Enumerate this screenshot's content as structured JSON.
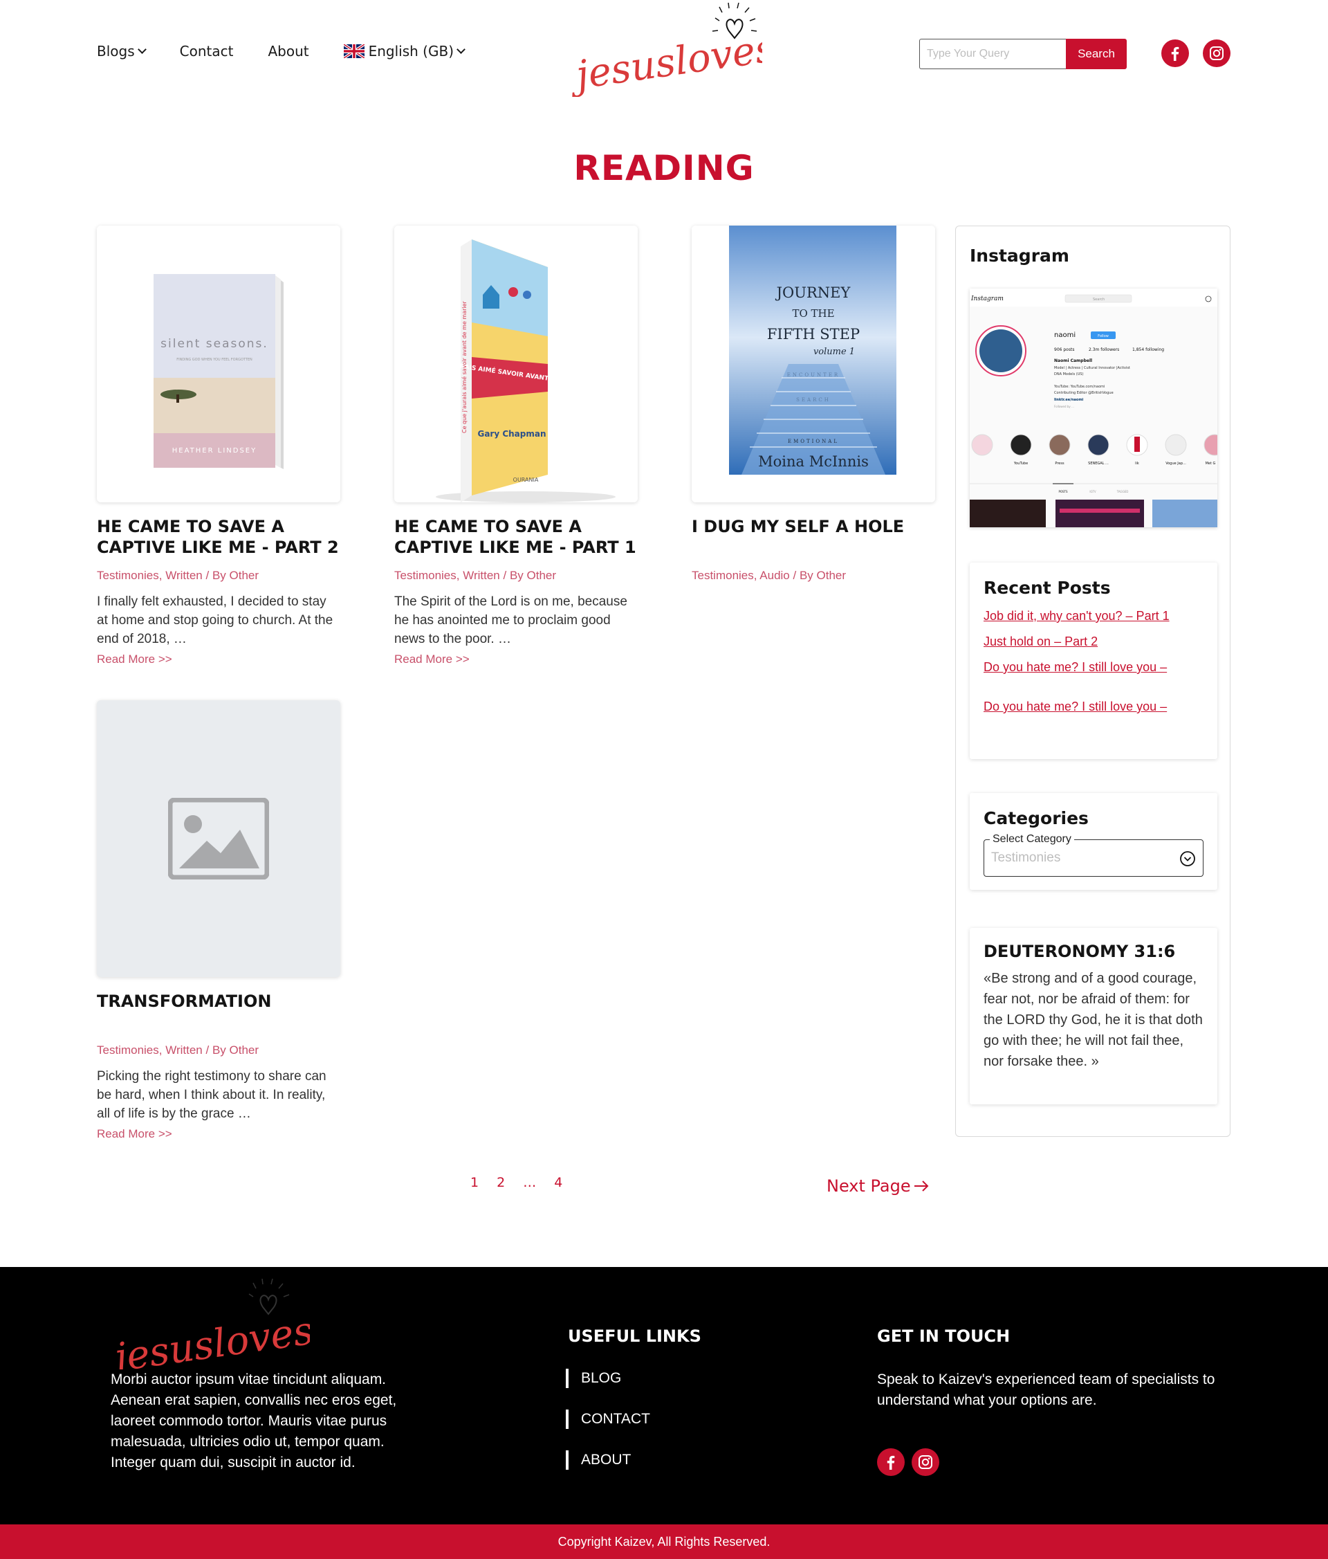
{
  "header": {
    "nav": [
      {
        "label": "Blogs",
        "has_dropdown": true
      },
      {
        "label": "Contact",
        "has_dropdown": false
      },
      {
        "label": "About",
        "has_dropdown": false
      }
    ],
    "language": {
      "label": "English (GB)",
      "flag": "uk-flag-icon"
    },
    "logo_text": "jesuslovesyou",
    "search": {
      "placeholder": "Type Your Query",
      "value": "",
      "button_label": "Search"
    },
    "social": [
      "facebook-icon",
      "instagram-icon"
    ]
  },
  "page_title": "READING",
  "posts": [
    {
      "title": "HE CAME TO SAVE A CAPTIVE LIKE ME - PART 2",
      "categories": [
        "Testimonies",
        "Written"
      ],
      "author_prefix": "/ By",
      "author": "Other",
      "excerpt": "I finally felt exhausted, I decided to stay at home and stop going to church. At the end of 2018, …",
      "read_more": "Read More >>",
      "image": {
        "title": "silent seasons.",
        "subtitle": "FINDING GOD WHEN YOU FEEL FORGOTTEN",
        "author": "HEATHER LINDSEY"
      }
    },
    {
      "title": "HE CAME TO SAVE A CAPTIVE LIKE ME - PART 1",
      "categories": [
        "Testimonies",
        "Written"
      ],
      "author_prefix": "/ By",
      "author": "Other",
      "excerpt": "The Spirit of the Lord is on me, because he has anointed me to proclaim good news to the poor. …",
      "read_more": "Read More >>",
      "image": {
        "title": "CE QUE J'AURAIS AIMÉ SAVOIR AVANT DE ME MARIER",
        "author": "Gary Chapman",
        "publisher": "OURANIA"
      }
    },
    {
      "title": "I DUG MY SELF A HOLE",
      "categories": [
        "Testimonies",
        "Audio"
      ],
      "author_prefix": "/ By",
      "author": "Other",
      "excerpt": "",
      "read_more": "",
      "image": {
        "line1": "JOURNEY",
        "line2": "TO THE",
        "line3": "FIFTH STEP",
        "volume": "volume 1",
        "words": [
          "ENCOUNTER",
          "SEARCH",
          "EMOTIONAL"
        ],
        "author": "Moina McInnis"
      }
    },
    {
      "title": "TRANSFORMATION",
      "categories": [
        "Testimonies",
        "Written"
      ],
      "author_prefix": "/ By",
      "author": "Other",
      "excerpt": "Picking the right testimony to share can be hard, when I think about it. In reality, all of life is by the grace …",
      "read_more": "Read More >>",
      "image": {
        "placeholder": "image-placeholder-icon"
      }
    }
  ],
  "sidebar": {
    "instagram": {
      "title": "Instagram",
      "profile": {
        "app": "Instagram",
        "search": "Search",
        "username": "naomi",
        "follow": "Follow",
        "posts": "906 posts",
        "followers": "2.3m followers",
        "following": "1,854 following",
        "name": "Naomi Campbell",
        "bio": [
          "Model | Actress | Cultural Innovator |Activist",
          "DNA Models (US)",
          "YouTube: YouTube.com/naomi",
          "Contributing Editor @BritishVogue"
        ],
        "link": "linktr.ee/naomi",
        "followed_by": "Followed by …",
        "highlights": [
          "",
          "YouTube",
          "Press",
          "SENEGAL ...",
          "lik",
          "Vogue Jap...",
          "Met G"
        ],
        "tabs": [
          "POSTS",
          "IGTV",
          "TAGGED"
        ]
      }
    },
    "recent_posts": {
      "title": "Recent Posts",
      "items": [
        "Job did it, why can't you? – Part 1",
        "Just hold on – Part 2",
        "Do you hate me? I still love you –",
        "Do you hate me? I still love you –"
      ]
    },
    "categories": {
      "title": "Categories",
      "legend": "Select Category",
      "value": "Testimonies"
    },
    "verse": {
      "title": "DEUTERONOMY 31:6",
      "text": "«Be strong and of a good courage, fear not, nor be afraid of them: for the LORD thy God, he it is that doth go with thee; he will not fail thee, nor forsake thee. »"
    }
  },
  "pagination": {
    "pages": [
      "1",
      "2",
      "…",
      "4"
    ],
    "next_label": "Next Page",
    "next_icon": "arrow-right-icon"
  },
  "footer": {
    "logo_text": "jesuslovesyou",
    "about": "Morbi auctor ipsum vitae tincidunt aliquam. Aenean erat sapien, convallis nec eros eget, laoreet commodo tortor. Mauris vitae purus malesuada, ultricies odio ut, tempor quam. Integer quam dui, suscipit in auctor id.",
    "useful_links_title": "USEFUL LINKS",
    "useful_links": [
      "BLOG",
      "CONTACT",
      "ABOUT"
    ],
    "get_in_touch_title": "GET IN TOUCH",
    "get_in_touch_text": "Speak to Kaizev's experienced team of specialists to understand what your options are.",
    "social": [
      "facebook-icon",
      "instagram-icon"
    ]
  },
  "copyright": "Copyright Kaizev, All Rights Reserved.",
  "colors": {
    "accent": "#c8102e",
    "footer_bg": "#000000",
    "meta": "#c8506a"
  }
}
